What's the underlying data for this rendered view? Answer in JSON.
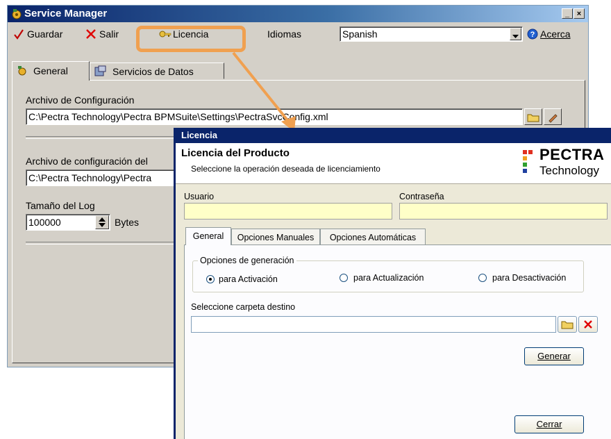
{
  "main_window": {
    "title": "Service Manager",
    "minimize_label": "_",
    "close_label": "×",
    "toolbar": {
      "save_label": "Guardar",
      "exit_label": "Salir",
      "license_label": "Licencia",
      "languages_label": "Idiomas",
      "language_value": "Spanish",
      "about_label": "Acerca"
    },
    "tabs": [
      {
        "label": "General"
      },
      {
        "label": "Servicios de Datos"
      }
    ],
    "config_file_label": "Archivo de Configuración",
    "config_file_value": "C:\\Pectra Technology\\Pectra BPMSuite\\Settings\\PectraSvcConfig.xml",
    "log_config_label": "Archivo de configuración del",
    "log_config_value": "C:\\Pectra Technology\\Pectra",
    "log_size_label": "Tamaño del Log",
    "log_size_value": "100000",
    "log_size_unit": "Bytes"
  },
  "dialog": {
    "title": "Licencia",
    "header_title": "Licencia del Producto",
    "header_subtitle": "Seleccione la operación deseada de licenciamiento",
    "brand_line1": "PECTRA",
    "brand_line2": "Technology",
    "user_label": "Usuario",
    "user_value": "",
    "password_label": "Contraseña",
    "password_value": "",
    "tabs": [
      {
        "label": "General"
      },
      {
        "label": "Opciones Manuales"
      },
      {
        "label": "Opciones Automáticas"
      }
    ],
    "group_label": "Opciones de generación",
    "radio_options": [
      {
        "label": "para Activación",
        "selected": true
      },
      {
        "label": "para Actualización",
        "selected": false
      },
      {
        "label": "para Desactivación",
        "selected": false
      }
    ],
    "folder_label": "Seleccione carpeta destino",
    "folder_value": "",
    "generate_label": "Generar",
    "close_label": "Cerrar"
  },
  "colors": {
    "callout": "#f0a050",
    "title_bar": "#0a246a",
    "input_highlight": "#ffffc8"
  }
}
